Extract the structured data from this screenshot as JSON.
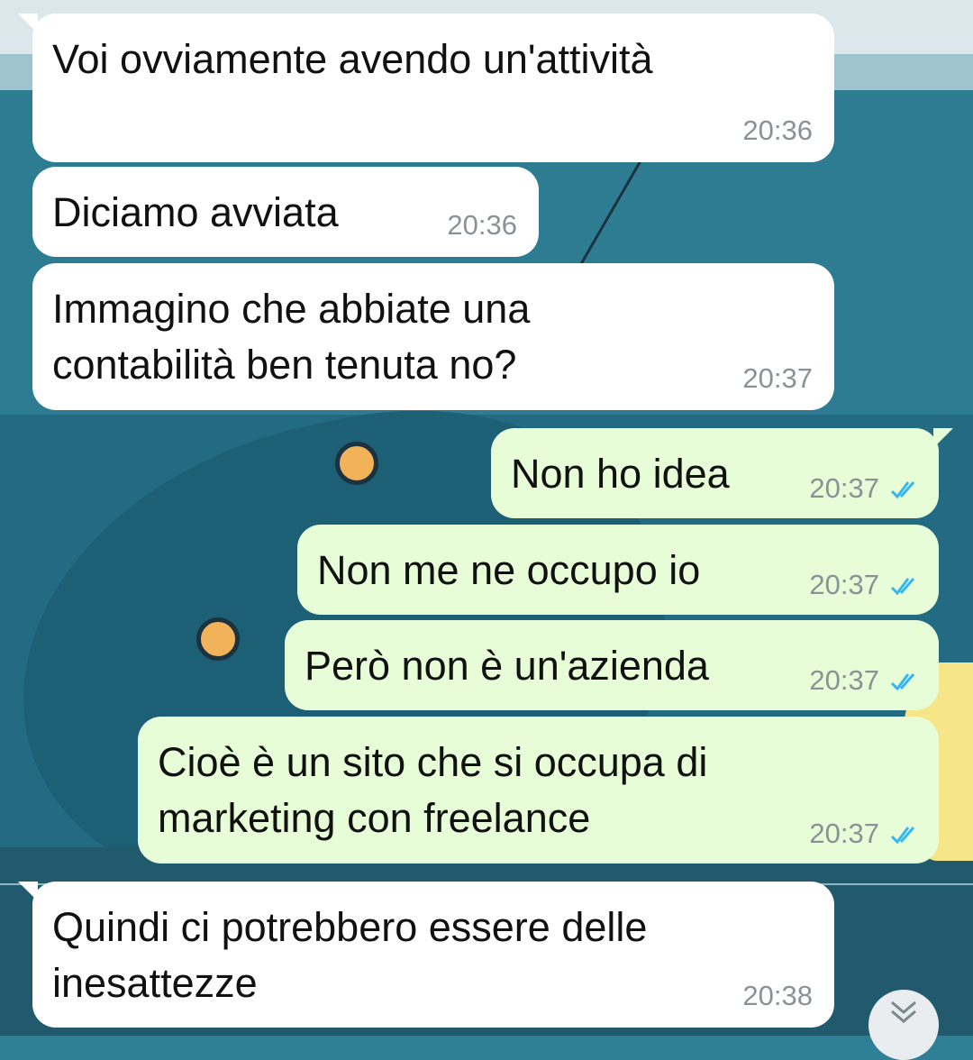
{
  "messages": [
    {
      "text": "Voi ovviamente avendo un'attività",
      "time": "20:36",
      "direction": "in"
    },
    {
      "text": "Diciamo avviata",
      "time": "20:36",
      "direction": "in"
    },
    {
      "text": "Immagino che abbiate una\ncontabilità ben tenuta no?",
      "time": "20:37",
      "direction": "in"
    },
    {
      "text": "Non ho idea",
      "time": "20:37",
      "direction": "out",
      "status": "read"
    },
    {
      "text": "Non me ne occupo io",
      "time": "20:37",
      "direction": "out",
      "status": "read"
    },
    {
      "text": "Però non è un'azienda",
      "time": "20:37",
      "direction": "out",
      "status": "read"
    },
    {
      "text": "Cioè è un sito che si occupa di\nmarketing con freelance",
      "time": "20:37",
      "direction": "out",
      "status": "read"
    },
    {
      "text": "Quindi ci potrebbero essere delle\ninesattezze",
      "time": "20:38",
      "direction": "in"
    }
  ],
  "icons": {
    "read_receipt": "double-check-icon",
    "scroll_down": "chevron-double-down-icon"
  },
  "colors": {
    "incoming_bubble": "#ffffff",
    "outgoing_bubble": "#e7fdd8",
    "timestamp": "#8a9296",
    "read_tick": "#34b7f1"
  }
}
